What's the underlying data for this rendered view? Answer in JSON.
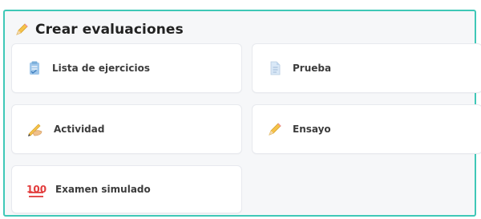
{
  "header": {
    "title": "Crear evaluaciones",
    "icon": "pencil-icon"
  },
  "cards": [
    {
      "label": "Lista de ejercicios",
      "icon": "clipboard-icon"
    },
    {
      "label": "Prueba",
      "icon": "document-icon"
    },
    {
      "label": "Actividad",
      "icon": "writing-hand-icon"
    },
    {
      "label": "Ensayo",
      "icon": "pencil-icon"
    },
    {
      "label": "Examen simulado",
      "icon": "hundred-points-icon",
      "icon_text": "100"
    }
  ],
  "colors": {
    "panel_border": "#3fc8b7",
    "panel_background": "#f6f7f9",
    "card_background": "#ffffff",
    "card_border": "#e7e9ee"
  }
}
